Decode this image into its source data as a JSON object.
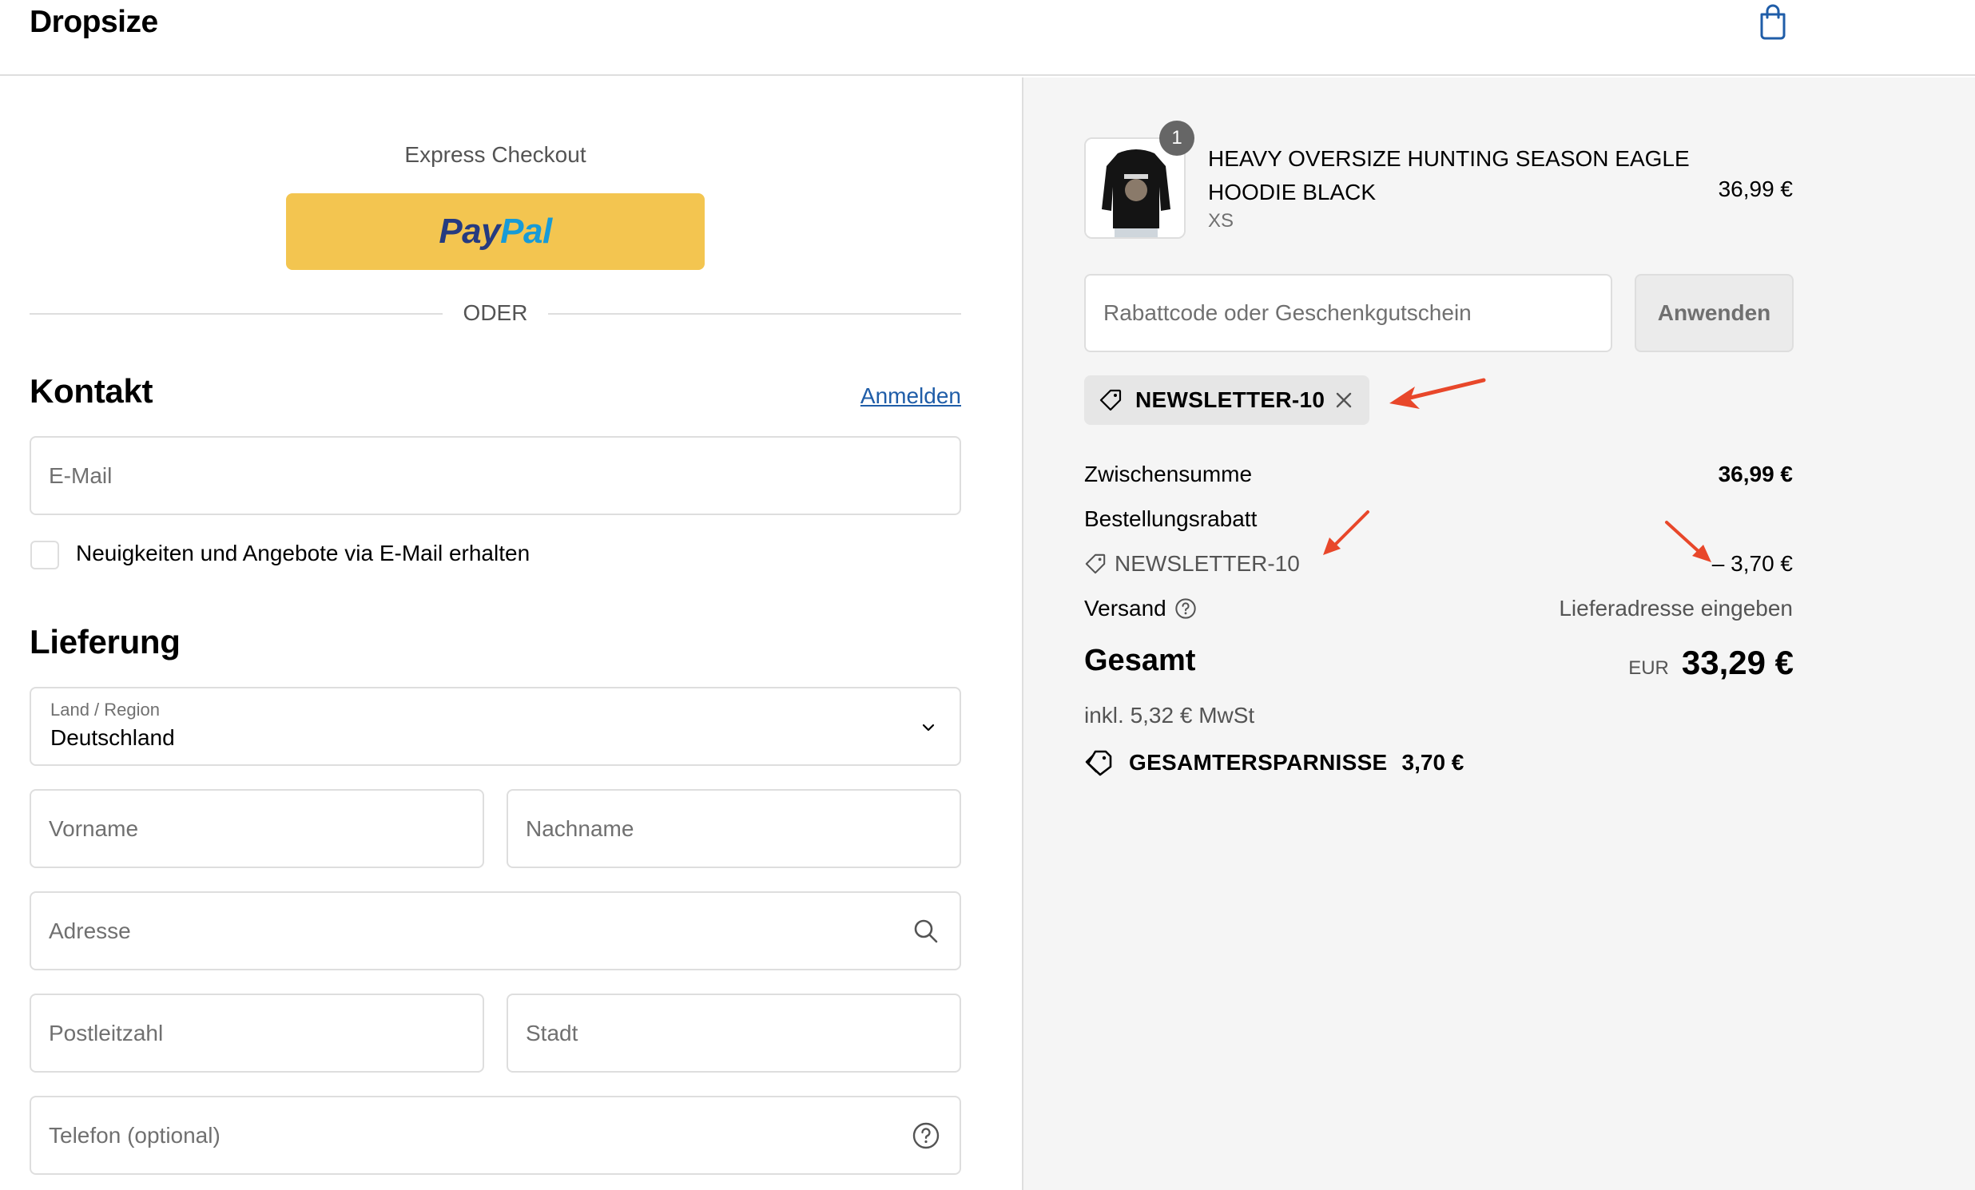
{
  "header": {
    "brand": "Dropsize"
  },
  "express": {
    "title": "Express Checkout",
    "paypal_part1": "Pay",
    "paypal_part2": "Pal",
    "divider_text": "ODER"
  },
  "contact": {
    "heading": "Kontakt",
    "login_link": "Anmelden",
    "email_placeholder": "E-Mail",
    "newsletter_label": "Neuigkeiten und Angebote via E-Mail erhalten",
    "newsletter_checked": false
  },
  "delivery": {
    "heading": "Lieferung",
    "country_label": "Land / Region",
    "country_value": "Deutschland",
    "firstname_placeholder": "Vorname",
    "lastname_placeholder": "Nachname",
    "address_placeholder": "Adresse",
    "zip_placeholder": "Postleitzahl",
    "city_placeholder": "Stadt",
    "phone_placeholder": "Telefon (optional)"
  },
  "cart": {
    "item": {
      "quantity": "1",
      "title": "HEAVY OVERSIZE HUNTING SEASON EAGLE HOODIE BLACK",
      "variant": "XS",
      "price": "36,99 €"
    },
    "discount_placeholder": "Rabattcode oder Geschenkgutschein",
    "apply_label": "Anwenden",
    "applied_code": "NEWSLETTER-10",
    "subtotal_label": "Zwischensumme",
    "subtotal_value": "36,99 €",
    "order_discount_label": "Bestellungsrabatt",
    "order_discount_code": "NEWSLETTER-10",
    "order_discount_value": "– 3,70 €",
    "shipping_label": "Versand",
    "shipping_value": "Lieferadresse eingeben",
    "total_label": "Gesamt",
    "total_currency": "EUR",
    "total_value": "33,29 €",
    "tax_note": "inkl. 5,32 € MwSt",
    "savings_label": "GESAMTERSPARNISSE",
    "savings_value": "3,70 €"
  },
  "colors": {
    "accent_link": "#1f5da8",
    "paypal_button": "#f3c550",
    "annotation_arrow": "#e8472a",
    "summary_background": "#f5f5f5",
    "cart_icon": "#1f5da8"
  }
}
